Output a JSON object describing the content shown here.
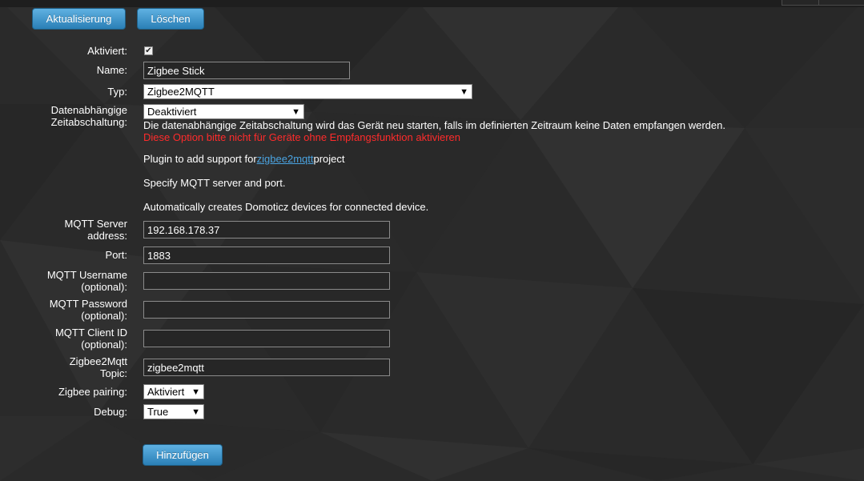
{
  "toolbar": {
    "update_label": "Aktualisierung",
    "delete_label": "Löschen"
  },
  "form": {
    "enabled": {
      "label": "Aktiviert:",
      "checked": true,
      "check_glyph": "✔"
    },
    "name": {
      "label": "Name:",
      "value": "Zigbee Stick"
    },
    "type": {
      "label": "Typ:",
      "value": "Zigbee2MQTT"
    },
    "timeout": {
      "label_line1": "Datenabhängige",
      "label_line2": "Zeitabschaltung:",
      "value": "Deaktiviert"
    },
    "description": {
      "timeout_info": "Die datenabhängige Zeitabschaltung wird das Gerät neu starten, falls im definierten Zeitraum keine Daten empfangen werden.",
      "timeout_warning": "Diese Option bitte nicht für Geräte ohne Empfangsfunktion aktivieren",
      "plugin_prefix": "Plugin to add support for",
      "plugin_link": "zigbee2mqtt",
      "plugin_suffix": "project",
      "specify": "Specify MQTT server and port.",
      "auto": "Automatically creates Domoticz devices for connected device."
    },
    "mqtt_server": {
      "label_line1": "MQTT Server",
      "label_line2": "address:",
      "value": "192.168.178.37"
    },
    "port": {
      "label": "Port:",
      "value": "1883"
    },
    "username": {
      "label_line1": "MQTT Username",
      "label_line2": "(optional):",
      "value": ""
    },
    "password": {
      "label_line1": "MQTT Password",
      "label_line2": "(optional):",
      "value": ""
    },
    "client_id": {
      "label_line1": "MQTT Client ID",
      "label_line2": "(optional):",
      "value": ""
    },
    "topic": {
      "label_line1": "Zigbee2Mqtt",
      "label_line2": "Topic:",
      "value": "zigbee2mqtt"
    },
    "pairing": {
      "label": "Zigbee pairing:",
      "value": "Aktiviert"
    },
    "debug": {
      "label": "Debug:",
      "value": "True"
    }
  },
  "footer": {
    "add_label": "Hinzufügen"
  },
  "icons": {
    "dropdown": "▼"
  },
  "colors": {
    "background": "#2b2b2b",
    "button": "#3a8fc6",
    "warning": "#ff2b2b",
    "link": "#4aa3e0"
  }
}
